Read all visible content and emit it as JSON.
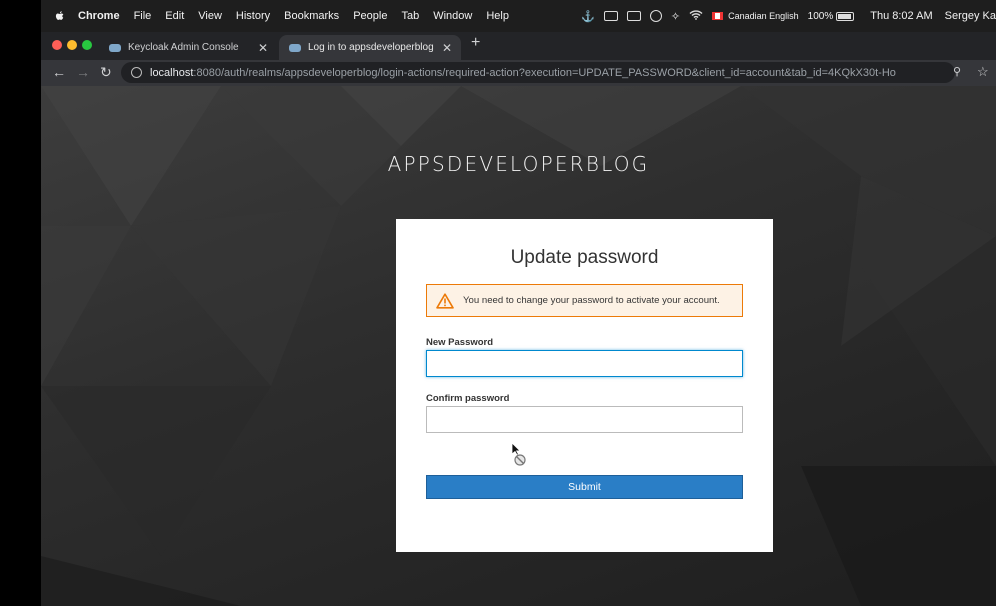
{
  "menubar": {
    "app": "Chrome",
    "items": [
      "File",
      "Edit",
      "View",
      "History",
      "Bookmarks",
      "People",
      "Tab",
      "Window",
      "Help"
    ],
    "input_source": "Canadian English",
    "battery": "100%",
    "clock": "Thu 8:02 AM",
    "user": "Sergey Ka"
  },
  "tabs": [
    {
      "title": "Keycloak Admin Console",
      "active": false
    },
    {
      "title": "Log in to appsdeveloperblog",
      "active": true
    }
  ],
  "address_bar": {
    "host": "localhost",
    "rest": ":8080/auth/realms/appsdeveloperblog/login-actions/required-action?execution=UPDATE_PASSWORD&client_id=account&tab_id=4KQkX30t-Ho"
  },
  "page": {
    "realm_title": "APPSDEVELOPERBLOG",
    "form_title": "Update password",
    "alert": "You need to change your password to activate your account.",
    "new_password_label": "New Password",
    "new_password_value": "",
    "confirm_password_label": "Confirm password",
    "confirm_password_value": "",
    "submit_label": "Submit"
  },
  "colors": {
    "alert_border": "#ec7a08",
    "alert_background": "#fdf2e5",
    "submit_button": "#2a7ec6",
    "focus_border": "#0088ce"
  }
}
